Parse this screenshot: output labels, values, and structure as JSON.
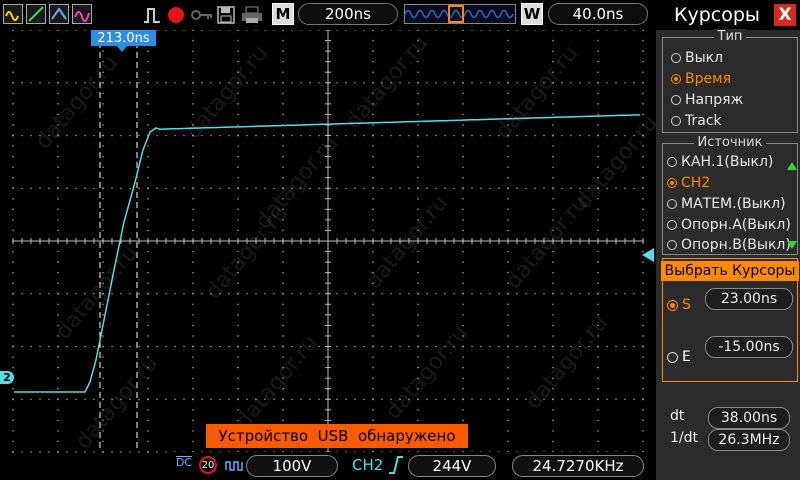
{
  "toolbar": {
    "time_div": "200ns",
    "mode_M": "M",
    "mode_W": "W",
    "window_time": "40.0ns"
  },
  "cursor_tag": "213.0ns",
  "channel_marker": "2",
  "usb_message": "Устройство  USB  обнаружено",
  "bottom": {
    "coupling": "DC",
    "bw_limit": "20",
    "ch_volts": "100V",
    "trig_source": "CH2",
    "trig_level": "244V",
    "frequency": "24.7270KHz"
  },
  "panel": {
    "title": "Курсоры",
    "close": "X",
    "type_group": {
      "title": "Тип",
      "options": [
        "Выкл",
        "Время",
        "Напряж",
        "Track"
      ],
      "selected": 1
    },
    "source_group": {
      "title": "Источник",
      "options": [
        "КАН.1(Выкл)",
        "CH2",
        "МАТЕМ.(Выкл)",
        "Опорн.A(Выкл)",
        "Опорн.B(Выкл)"
      ],
      "selected": 1
    },
    "select_cursors": {
      "title": "Выбрать  Курсоры",
      "s_label": "S",
      "s_value": "23.00ns",
      "e_label": "E",
      "e_value": "-15.00ns"
    },
    "measure": {
      "dt_label": "dt",
      "dt_value": "38.00ns",
      "inv_dt_label": "1/dt",
      "inv_dt_value": "26.3MHz"
    }
  },
  "watermark": "datagor.ru",
  "colors": {
    "trace": "#4fe0e6",
    "accent": "#ff8a00",
    "usb_bg": "#ff5a00",
    "cursor_tag": "#2d8de0",
    "close_btn": "#d62a1d"
  }
}
